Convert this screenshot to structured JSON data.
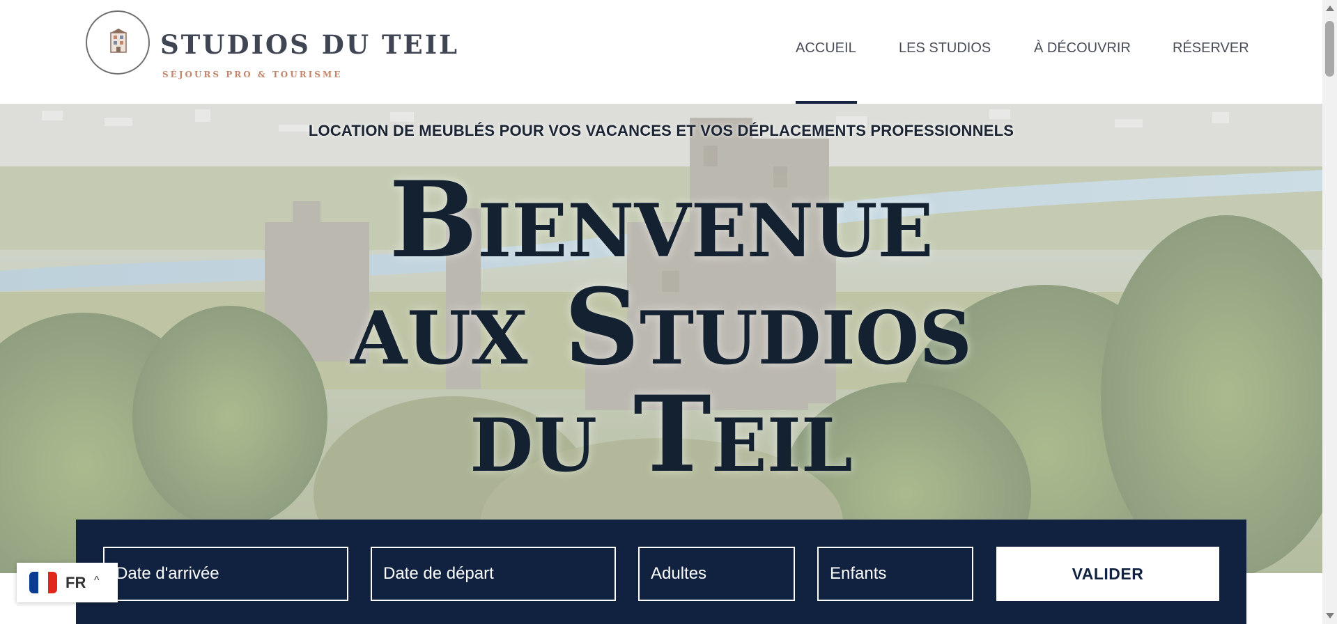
{
  "brand": {
    "title": "STUDIOS DU TEIL",
    "subtitle": "SÉJOURS PRO & TOURISME",
    "logo_icon": "building-icon"
  },
  "nav": {
    "items": [
      {
        "label": "ACCUEIL",
        "active": true
      },
      {
        "label": "LES STUDIOS",
        "active": false
      },
      {
        "label": "À DÉCOUVRIR",
        "active": false
      },
      {
        "label": "RÉSERVER",
        "active": false
      }
    ]
  },
  "hero": {
    "tagline": "LOCATION DE MEUBLÉS POUR VOS VACANCES ET VOS DÉPLACEMENTS PROFESSIONNELS",
    "heading_lines": [
      "Bienvenue",
      "aux Studios",
      "du Teil"
    ]
  },
  "booking": {
    "arrival_placeholder": "Date d'arrivée",
    "departure_placeholder": "Date de départ",
    "adults_placeholder": "Adultes",
    "children_placeholder": "Enfants",
    "submit_label": "VALIDER"
  },
  "language": {
    "code": "FR",
    "chevron": "^",
    "flag_icon": "france-flag-icon"
  },
  "colors": {
    "navy": "#112240",
    "heading": "#142131",
    "nav_text": "#474c57",
    "brand_accent": "#c3866b"
  }
}
